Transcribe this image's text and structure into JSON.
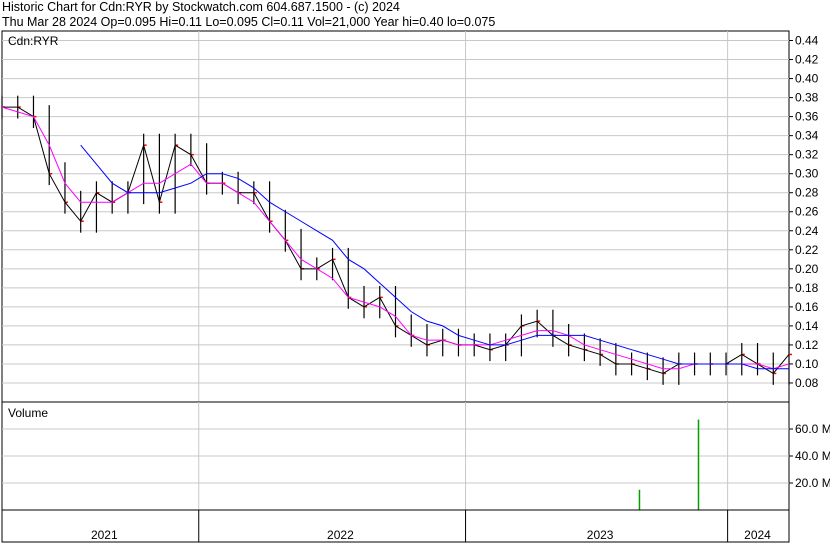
{
  "header": {
    "line1": "Historic Chart for Cdn:RYR by Stockwatch.com 604.687.1500 - (c) 2024",
    "line2": "Thu Mar 28 2024  Op=0.095  Hi=0.11  Lo=0.095  Cl=0.11  Vol=21,000  Year hi=0.40  lo=0.075"
  },
  "chart_data": [
    {
      "type": "line",
      "title": "Cdn:RYR",
      "ylim": [
        0.06,
        0.45
      ],
      "yticks": [
        "0.44",
        "0.42",
        "0.40",
        "0.38",
        "0.36",
        "0.34",
        "0.32",
        "0.30",
        "0.28",
        "0.26",
        "0.24",
        "0.22",
        "0.20",
        "0.18",
        "0.16",
        "0.14",
        "0.12",
        "0.10",
        "0.08"
      ],
      "grid": true,
      "colors": {
        "price": "#000000",
        "ma_short": "#ff00ff",
        "ma_long": "#0000ff",
        "close_tick": "#ff0000"
      },
      "x": [
        0,
        0.02,
        0.04,
        0.06,
        0.08,
        0.1,
        0.12,
        0.14,
        0.16,
        0.18,
        0.2,
        0.22,
        0.24,
        0.26,
        0.28,
        0.3,
        0.32,
        0.34,
        0.36,
        0.38,
        0.4,
        0.42,
        0.44,
        0.46,
        0.48,
        0.5,
        0.52,
        0.54,
        0.56,
        0.58,
        0.6,
        0.62,
        0.64,
        0.66,
        0.68,
        0.7,
        0.72,
        0.74,
        0.76,
        0.78,
        0.8,
        0.82,
        0.84,
        0.86,
        0.88,
        0.9,
        0.92,
        0.94,
        0.96,
        0.98,
        1.0
      ],
      "series": [
        {
          "values": [
            0.37,
            0.37,
            0.36,
            0.3,
            0.27,
            0.25,
            0.28,
            0.27,
            0.28,
            0.33,
            0.27,
            0.33,
            0.32,
            0.29,
            0.29,
            0.28,
            0.28,
            0.25,
            0.23,
            0.2,
            0.2,
            0.21,
            0.17,
            0.16,
            0.17,
            0.14,
            0.13,
            0.12,
            0.125,
            0.12,
            0.12,
            0.115,
            0.12,
            0.14,
            0.145,
            0.13,
            0.12,
            0.115,
            0.11,
            0.1,
            0.1,
            0.095,
            0.09,
            0.1,
            0.1,
            0.1,
            0.1,
            0.11,
            0.1,
            0.09,
            0.11
          ]
        },
        {
          "values": [
            0.37,
            0.365,
            0.36,
            0.33,
            0.29,
            0.27,
            0.27,
            0.27,
            0.28,
            0.29,
            0.29,
            0.3,
            0.31,
            0.29,
            0.29,
            0.28,
            0.27,
            0.25,
            0.23,
            0.21,
            0.2,
            0.19,
            0.17,
            0.165,
            0.16,
            0.15,
            0.13,
            0.125,
            0.125,
            0.12,
            0.12,
            0.12,
            0.125,
            0.13,
            0.135,
            0.135,
            0.13,
            0.12,
            0.115,
            0.11,
            0.105,
            0.1,
            0.095,
            0.095,
            0.1,
            0.1,
            0.1,
            0.1,
            0.1,
            0.095,
            0.1
          ]
        },
        {
          "values": [
            null,
            null,
            null,
            null,
            null,
            0.33,
            0.31,
            0.29,
            0.28,
            0.28,
            0.28,
            0.285,
            0.29,
            0.3,
            0.3,
            0.295,
            0.285,
            0.27,
            0.26,
            0.25,
            0.24,
            0.23,
            0.21,
            0.2,
            0.185,
            0.17,
            0.155,
            0.145,
            0.14,
            0.13,
            0.125,
            0.12,
            0.12,
            0.125,
            0.13,
            0.13,
            0.13,
            0.13,
            0.125,
            0.12,
            0.115,
            0.11,
            0.105,
            0.1,
            0.1,
            0.1,
            0.1,
            0.1,
            0.095,
            0.095,
            0.095
          ]
        }
      ]
    },
    {
      "type": "bar",
      "title": "Volume",
      "ylim": [
        0,
        80000000
      ],
      "yticks": [
        "60.0 M",
        "40.0 M",
        "20.0 M"
      ],
      "grid": true,
      "x": [
        0.81,
        0.885
      ],
      "values": [
        15000000,
        67000000
      ],
      "colors": {
        "bar": "#00a000"
      }
    }
  ],
  "x_axis": {
    "labels": [
      "2021",
      "2022",
      "2023",
      "2024"
    ],
    "label_positions": [
      0.13,
      0.43,
      0.76,
      0.96
    ],
    "year_breaks": [
      0.25,
      0.589,
      0.922
    ]
  }
}
